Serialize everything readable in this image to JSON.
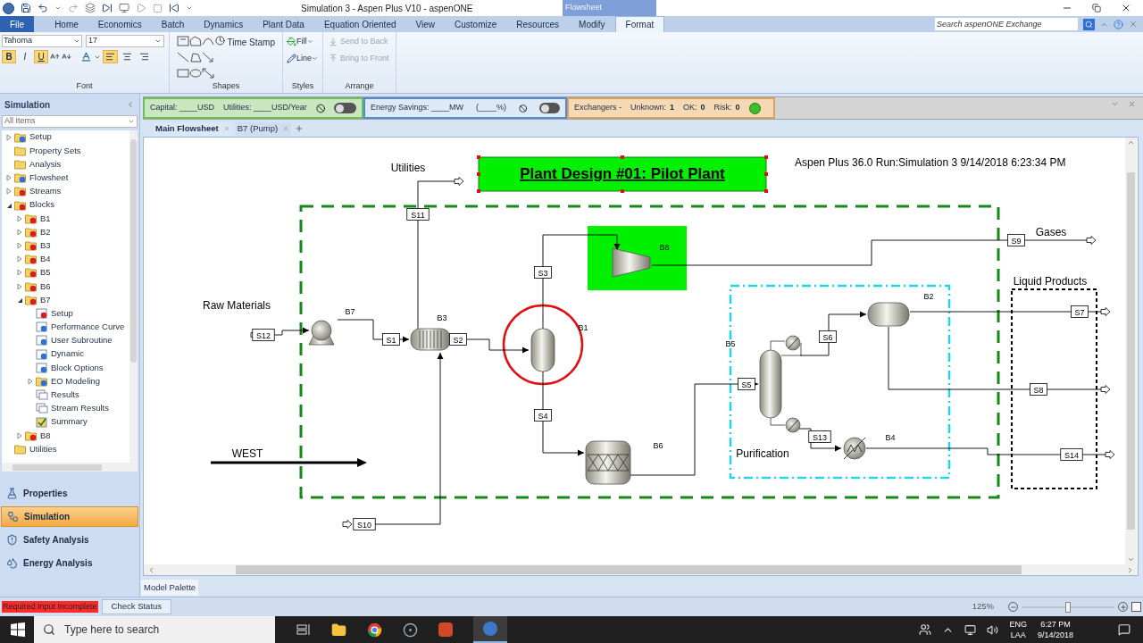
{
  "window": {
    "title": "Simulation 3 - Aspen Plus V10 - aspenONE",
    "context_tab": "Flowsheet"
  },
  "ribbon_tabs": [
    {
      "label": "File",
      "selected": false
    },
    {
      "label": "Home",
      "selected": false
    },
    {
      "label": "Economics",
      "selected": false
    },
    {
      "label": "Batch",
      "selected": false
    },
    {
      "label": "Dynamics",
      "selected": false
    },
    {
      "label": "Plant Data",
      "selected": false
    },
    {
      "label": "Equation Oriented",
      "selected": false
    },
    {
      "label": "View",
      "selected": false
    },
    {
      "label": "Customize",
      "selected": false
    },
    {
      "label": "Resources",
      "selected": false
    },
    {
      "label": "Modify",
      "selected": false
    },
    {
      "label": "Format",
      "selected": true
    }
  ],
  "search": {
    "placeholder": "Search aspenONE Exchange"
  },
  "font_group": {
    "label": "Font",
    "font": "Tahoma",
    "size": "17",
    "styles": [
      {
        "label": "B",
        "selected": true
      },
      {
        "label": "I",
        "selected": false
      },
      {
        "label": "U",
        "selected": true
      }
    ],
    "align": [
      {
        "selected": true
      },
      {
        "selected": false
      },
      {
        "selected": false
      }
    ]
  },
  "shapes_group": {
    "label": "Shapes",
    "time_stamp": "Time Stamp"
  },
  "styles_group": {
    "label": "Styles",
    "fill": "Fill",
    "line": "Line"
  },
  "arrange_group": {
    "label": "Arrange",
    "buttons": [
      {
        "label": "Send to Back",
        "disabled": true
      },
      {
        "label": "Bring to Front",
        "disabled": true
      }
    ]
  },
  "cost_panel": {
    "capital": "Capital: ____USD",
    "utilities": "Utilities: ____USD/Year",
    "on": false
  },
  "energy_panel": {
    "savings": "Energy Savings: ____MW",
    "percent": "(____%)",
    "on": false
  },
  "exchanger_panel": {
    "title": "Exchangers -",
    "counts": [
      {
        "label": "Unknown:",
        "value": "1"
      },
      {
        "label": "OK:",
        "value": "0"
      },
      {
        "label": "Risk:",
        "value": "0"
      }
    ]
  },
  "navigator": {
    "title": "Simulation",
    "filter": "All Items",
    "tree": [
      {
        "label": "Setup",
        "kind": "folder",
        "color": "#2f6fd6",
        "expanded": false
      },
      {
        "label": "Property Sets",
        "kind": "folder"
      },
      {
        "label": "Analysis",
        "kind": "folder"
      },
      {
        "label": "Flowsheet",
        "kind": "folder",
        "color": "#2f6fd6",
        "expanded": false
      },
      {
        "label": "Streams",
        "kind": "folder",
        "color": "#d62020",
        "expanded": false
      },
      {
        "label": "Blocks",
        "kind": "folder",
        "color": "#d62020",
        "expanded": true,
        "children": [
          {
            "label": "B1",
            "kind": "folder",
            "color": "#d62020",
            "expanded": false
          },
          {
            "label": "B2",
            "kind": "folder",
            "color": "#d62020",
            "expanded": false
          },
          {
            "label": "B3",
            "kind": "folder",
            "color": "#d62020",
            "expanded": false
          },
          {
            "label": "B4",
            "kind": "folder",
            "color": "#d62020",
            "expanded": false
          },
          {
            "label": "B5",
            "kind": "folder",
            "color": "#d62020",
            "expanded": false
          },
          {
            "label": "B6",
            "kind": "folder",
            "color": "#d62020",
            "expanded": false
          },
          {
            "label": "B7",
            "kind": "folder",
            "color": "#d62020",
            "expanded": true,
            "children": [
              {
                "label": "Setup",
                "kind": "form",
                "color": "#d62020"
              },
              {
                "label": "Performance Curve",
                "kind": "form",
                "color": "#2f6fd6"
              },
              {
                "label": "User Subroutine",
                "kind": "form",
                "color": "#2f6fd6"
              },
              {
                "label": "Dynamic",
                "kind": "form",
                "color": "#2f6fd6"
              },
              {
                "label": "Block Options",
                "kind": "form",
                "color": "#2f6fd6"
              },
              {
                "label": "EO Modeling",
                "kind": "folder",
                "color": "#2f6fd6",
                "expanded": false
              },
              {
                "label": "Results",
                "kind": "results"
              },
              {
                "label": "Stream Results",
                "kind": "results"
              },
              {
                "label": "Summary",
                "kind": "summary"
              }
            ]
          },
          {
            "label": "B8",
            "kind": "folder",
            "color": "#d62020",
            "expanded": false
          }
        ]
      },
      {
        "label": "Utilities",
        "kind": "folder"
      }
    ]
  },
  "nav_buttons": [
    {
      "label": "Properties",
      "kind": "properties",
      "selected": false
    },
    {
      "label": "Simulation",
      "kind": "simulation",
      "selected": true
    },
    {
      "label": "Safety Analysis",
      "kind": "safety",
      "selected": false
    },
    {
      "label": "Energy Analysis",
      "kind": "energy",
      "selected": false
    }
  ],
  "doc_tabs": [
    {
      "label": "Main Flowsheet",
      "selected": true
    },
    {
      "label": "B7 (Pump)",
      "selected": false
    }
  ],
  "flowsheet": {
    "title": "Plant Design #01: Pilot Plant",
    "run_info": "Aspen Plus 36.0 Run:Simulation 3 9/14/2018 6:23:34 PM",
    "annotations": [
      {
        "text": "Utilities"
      },
      {
        "text": "Raw Materials"
      },
      {
        "text": "WEST"
      },
      {
        "text": "Gases"
      },
      {
        "text": "Liquid Products"
      },
      {
        "text": "Purification"
      }
    ],
    "blocks": [
      {
        "label": "B7",
        "kind": "pump"
      },
      {
        "label": "B3",
        "kind": "heatx"
      },
      {
        "label": "B1",
        "kind": "flash"
      },
      {
        "label": "B8",
        "kind": "compressor"
      },
      {
        "label": "B6",
        "kind": "reactor"
      },
      {
        "label": "B5",
        "kind": "column"
      },
      {
        "label": "B2",
        "kind": "drum"
      },
      {
        "label": "B4",
        "kind": "heater"
      }
    ],
    "streams": [
      {
        "label": "S12"
      },
      {
        "label": "S1"
      },
      {
        "label": "S2"
      },
      {
        "label": "S11"
      },
      {
        "label": "S3"
      },
      {
        "label": "S4"
      },
      {
        "label": "S10"
      },
      {
        "label": "S9"
      },
      {
        "label": "S5"
      },
      {
        "label": "S6"
      },
      {
        "label": "S13"
      },
      {
        "label": "S7"
      },
      {
        "label": "S8"
      },
      {
        "label": "S14"
      }
    ]
  },
  "model_palette": "Model Palette",
  "status_bar": {
    "message": "Required Input Incomplete",
    "check_button": "Check Status",
    "zoom": "125%",
    "level": 0.5
  },
  "taskbar": {
    "search_placeholder": "Type here to search",
    "language": "ENG",
    "layout": "LAA",
    "time": "6:27 PM",
    "date": "9/14/2018"
  }
}
